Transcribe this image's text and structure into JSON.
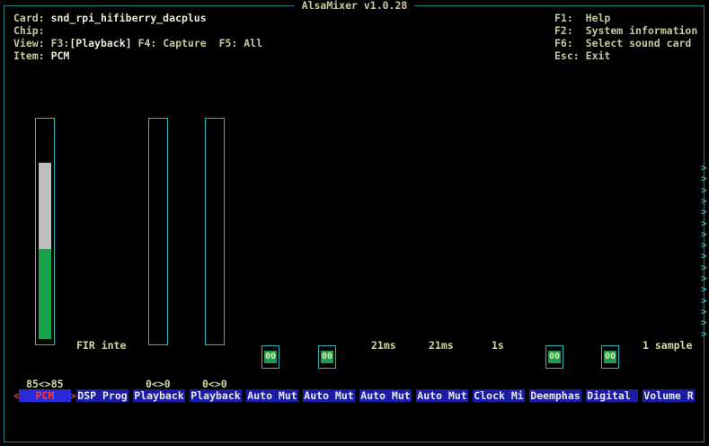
{
  "title": "AlsaMixer v1.0.28",
  "info": {
    "card_label": "Card:",
    "card": "snd_rpi_hifiberry_dacplus",
    "chip_label": "Chip:",
    "chip": "",
    "view_label": "View:",
    "view_f3": "F3:",
    "view_playback": "[Playback]",
    "view_f4": "F4: Capture",
    "view_f5": "F5: All",
    "item_label": "Item:",
    "item": "PCM"
  },
  "help": [
    {
      "key": "F1:",
      "text": "Help"
    },
    {
      "key": "F2:",
      "text": "System information"
    },
    {
      "key": "F6:",
      "text": "Select sound card"
    },
    {
      "key": "Esc:",
      "text": "Exit"
    }
  ],
  "controls": [
    {
      "name": "PCM",
      "value": "85<>85",
      "level": 0.85,
      "selected": true
    },
    {
      "name": "DSP Prog",
      "enum": "FIR inte"
    },
    {
      "name": "Playback",
      "value": "0<>0",
      "level": 0
    },
    {
      "name": "Playback",
      "value": "0<>0",
      "level": 0
    },
    {
      "name": "Auto Mut",
      "switch": "00"
    },
    {
      "name": "Auto Mut",
      "switch": "00"
    },
    {
      "name": "Auto Mut",
      "enum": "21ms"
    },
    {
      "name": "Auto Mut",
      "enum": "21ms"
    },
    {
      "name": "Clock Mi",
      "enum": "1s"
    },
    {
      "name": "Deemphas",
      "switch": "00"
    },
    {
      "name": "Digital ",
      "switch": "00"
    },
    {
      "name": "Volume R",
      "enum": "1 sample"
    }
  ],
  "scroll_glyph": ">",
  "selection_arrows": {
    "left": "<",
    "right": ">"
  },
  "colors": {
    "border": "#29b3bd",
    "level_low": "#16a34a",
    "level_high": "#bdbdbd",
    "name_bg": "#1b1ba6",
    "selected_text": "#f23a3a"
  }
}
